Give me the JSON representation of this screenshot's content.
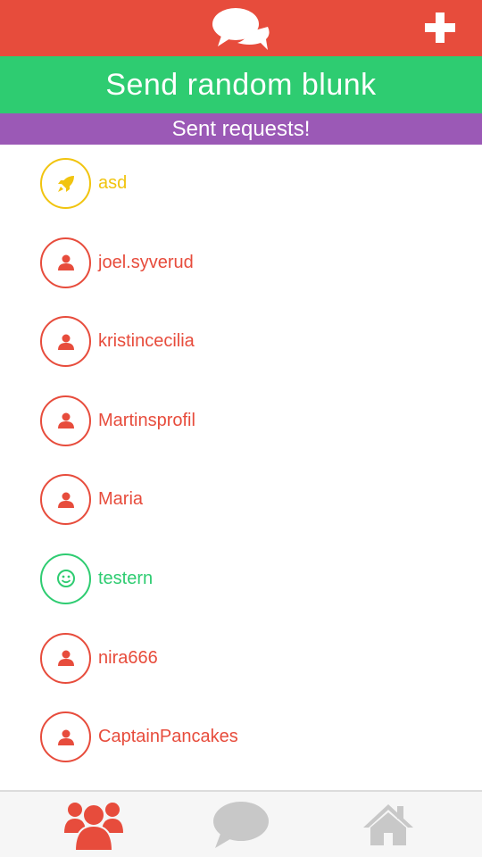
{
  "colors": {
    "red": "#e74c3c",
    "green": "#2ecc71",
    "purple": "#9b59b6",
    "yellow": "#f1c40f",
    "gray": "#c8c8c8"
  },
  "header": {
    "logo_icon": "chat-bubbles-icon",
    "add_icon": "plus-icon"
  },
  "send_random": {
    "label": "Send random blunk"
  },
  "sent_requests": {
    "label": "Sent requests!"
  },
  "contacts": [
    {
      "name": "asd",
      "icon": "rocket-icon",
      "status": "pending"
    },
    {
      "name": "joel.syverud",
      "icon": "user-icon",
      "status": "default"
    },
    {
      "name": "kristincecilia",
      "icon": "user-icon",
      "status": "default"
    },
    {
      "name": "Martinsprofil",
      "icon": "user-icon",
      "status": "default"
    },
    {
      "name": "Maria",
      "icon": "user-icon",
      "status": "default"
    },
    {
      "name": "testern",
      "icon": "smiley-icon",
      "status": "friend"
    },
    {
      "name": "nira666",
      "icon": "user-icon",
      "status": "default"
    },
    {
      "name": "CaptainPancakes",
      "icon": "user-icon",
      "status": "default"
    }
  ],
  "bottom_nav": [
    {
      "icon": "group-icon",
      "active": true
    },
    {
      "icon": "chat-icon",
      "active": false
    },
    {
      "icon": "home-icon",
      "active": false
    }
  ]
}
